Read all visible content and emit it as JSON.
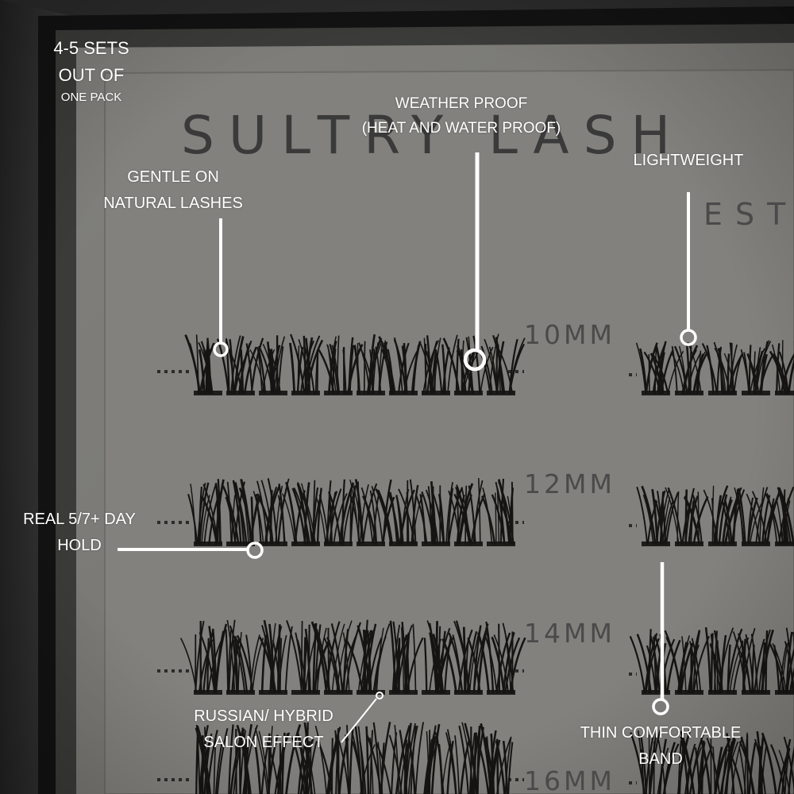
{
  "brand": {
    "title": "SULTRY LASH",
    "subtitle": "EST"
  },
  "rows": [
    {
      "length": "10MM"
    },
    {
      "length": "12MM"
    },
    {
      "length": "14MM"
    },
    {
      "length": "16MM"
    }
  ],
  "callouts": {
    "sets": {
      "line1": "4-5 SETS",
      "line2": "OUT OF",
      "line3": "ONE PACK"
    },
    "weather": {
      "line1": "WEATHER PROOF",
      "line2": "(HEAT AND WATER PROOF)"
    },
    "gentle": {
      "line1": "GENTLE ON",
      "line2": "NATURAL LASHES"
    },
    "lightweight": {
      "line1": "LIGHTWEIGHT"
    },
    "hold": {
      "line1": "REAL 5/7+ DAY",
      "line2": "HOLD"
    },
    "russian": {
      "line1": "RUSSIAN/ HYBRID",
      "line2": "SALON EFFECT"
    },
    "band": {
      "line1": "THIN COMFORTABLE",
      "line2": "BAND"
    }
  },
  "colors": {
    "tray": "#7c7b77",
    "box": "#1b1b1b",
    "lash": "#161412",
    "callout": "#ffffff"
  }
}
